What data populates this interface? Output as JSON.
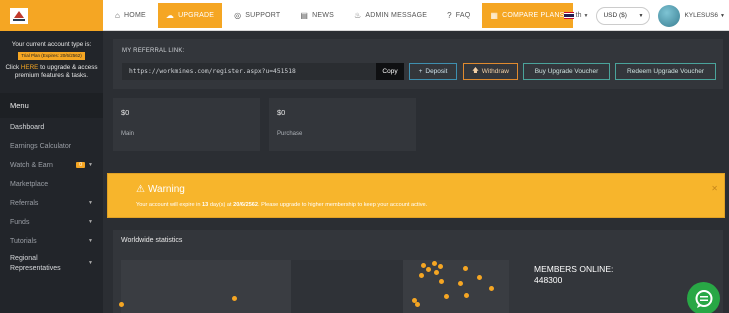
{
  "topbar": {
    "nav": [
      {
        "label": "HOME",
        "icon": "home-icon"
      },
      {
        "label": "UPGRADE",
        "icon": "cloud-upload-icon"
      },
      {
        "label": "SUPPORT",
        "icon": "lifebuoy-icon"
      },
      {
        "label": "NEWS",
        "icon": "newspaper-icon"
      },
      {
        "label": "ADMIN MESSAGE",
        "icon": "bell-icon"
      },
      {
        "label": "FAQ",
        "icon": "question-icon"
      },
      {
        "label": "COMPARE PLANS",
        "icon": "grid-icon"
      }
    ],
    "language": "th",
    "currency": "USD ($)",
    "username": "KYLESUS6"
  },
  "sidebar": {
    "promo_line1": "Your current account type is:",
    "plan_badge": "Trial Plan (Expires: 20/6/2562)",
    "promo_click": "Click ",
    "promo_here": "HERE",
    "promo_rest": " to upgrade & access premium features & tasks.",
    "menu_title": "Menu",
    "items": [
      {
        "label": "Dashboard"
      },
      {
        "label": "Earnings Calculator"
      },
      {
        "label": "Watch & Earn",
        "badge": "0"
      },
      {
        "label": "Marketplace"
      },
      {
        "label": "Referrals"
      },
      {
        "label": "Funds"
      },
      {
        "label": "Tutorials"
      },
      {
        "label": "Regional Representatives"
      }
    ]
  },
  "referral": {
    "title": "MY REFERRAL LINK:",
    "link": "https://workmines.com/register.aspx?u=451518",
    "copy": "Copy",
    "deposit": "Deposit",
    "withdraw": "Withdraw",
    "buy_voucher": "Buy Upgrade Voucher",
    "redeem_voucher": "Redeem Upgrade Voucher"
  },
  "balances": {
    "main_value": "$0",
    "main_label": "Main",
    "purchase_value": "$0",
    "purchase_label": "Purchase"
  },
  "warning": {
    "title": "Warning",
    "text_prefix": "Your account will expire in ",
    "days": "13",
    "text_mid": " day(s) at ",
    "date": "20/6/2562",
    "text_suffix": ". Please upgrade to higher membership to keep your account active."
  },
  "stats": {
    "title": "Worldwide statistics",
    "members_label": "MEMBERS ONLINE:",
    "members_count": "448300"
  },
  "colors": {
    "accent": "#f5a623",
    "sidebar_bg": "#22252a",
    "main_bg": "#2b2e33",
    "chat": "#28a745"
  }
}
